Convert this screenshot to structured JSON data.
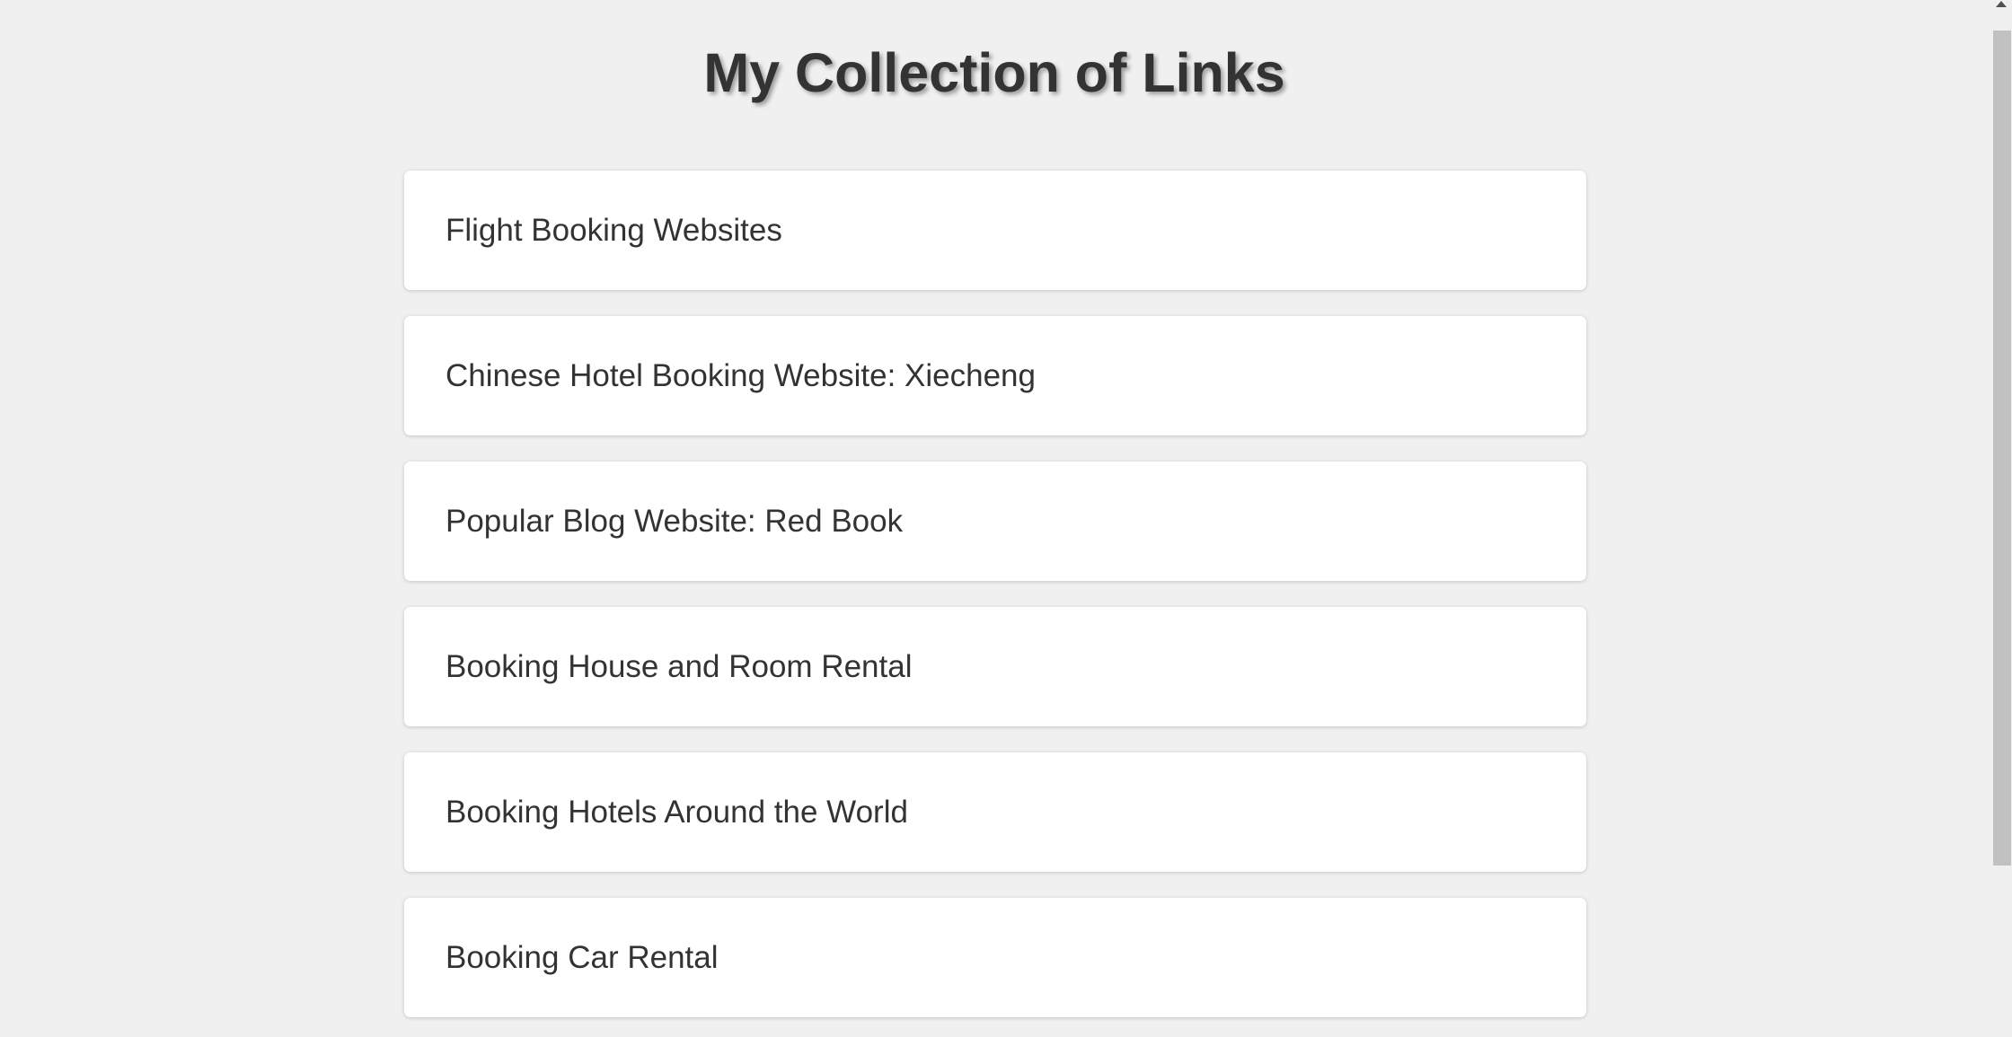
{
  "page": {
    "title": "My Collection of Links"
  },
  "links": [
    {
      "label": "Flight Booking Websites"
    },
    {
      "label": "Chinese Hotel Booking Website: Xiecheng"
    },
    {
      "label": "Popular Blog Website: Red Book"
    },
    {
      "label": "Booking House and Room Rental"
    },
    {
      "label": "Booking Hotels Around the World"
    },
    {
      "label": "Booking Car Rental"
    }
  ],
  "colors": {
    "background": "#f0f0f0",
    "card": "#ffffff",
    "text": "#333333",
    "scroll_thumb": "#c1c1c1"
  },
  "icons": {
    "scroll_up": "triangle-up-icon"
  }
}
